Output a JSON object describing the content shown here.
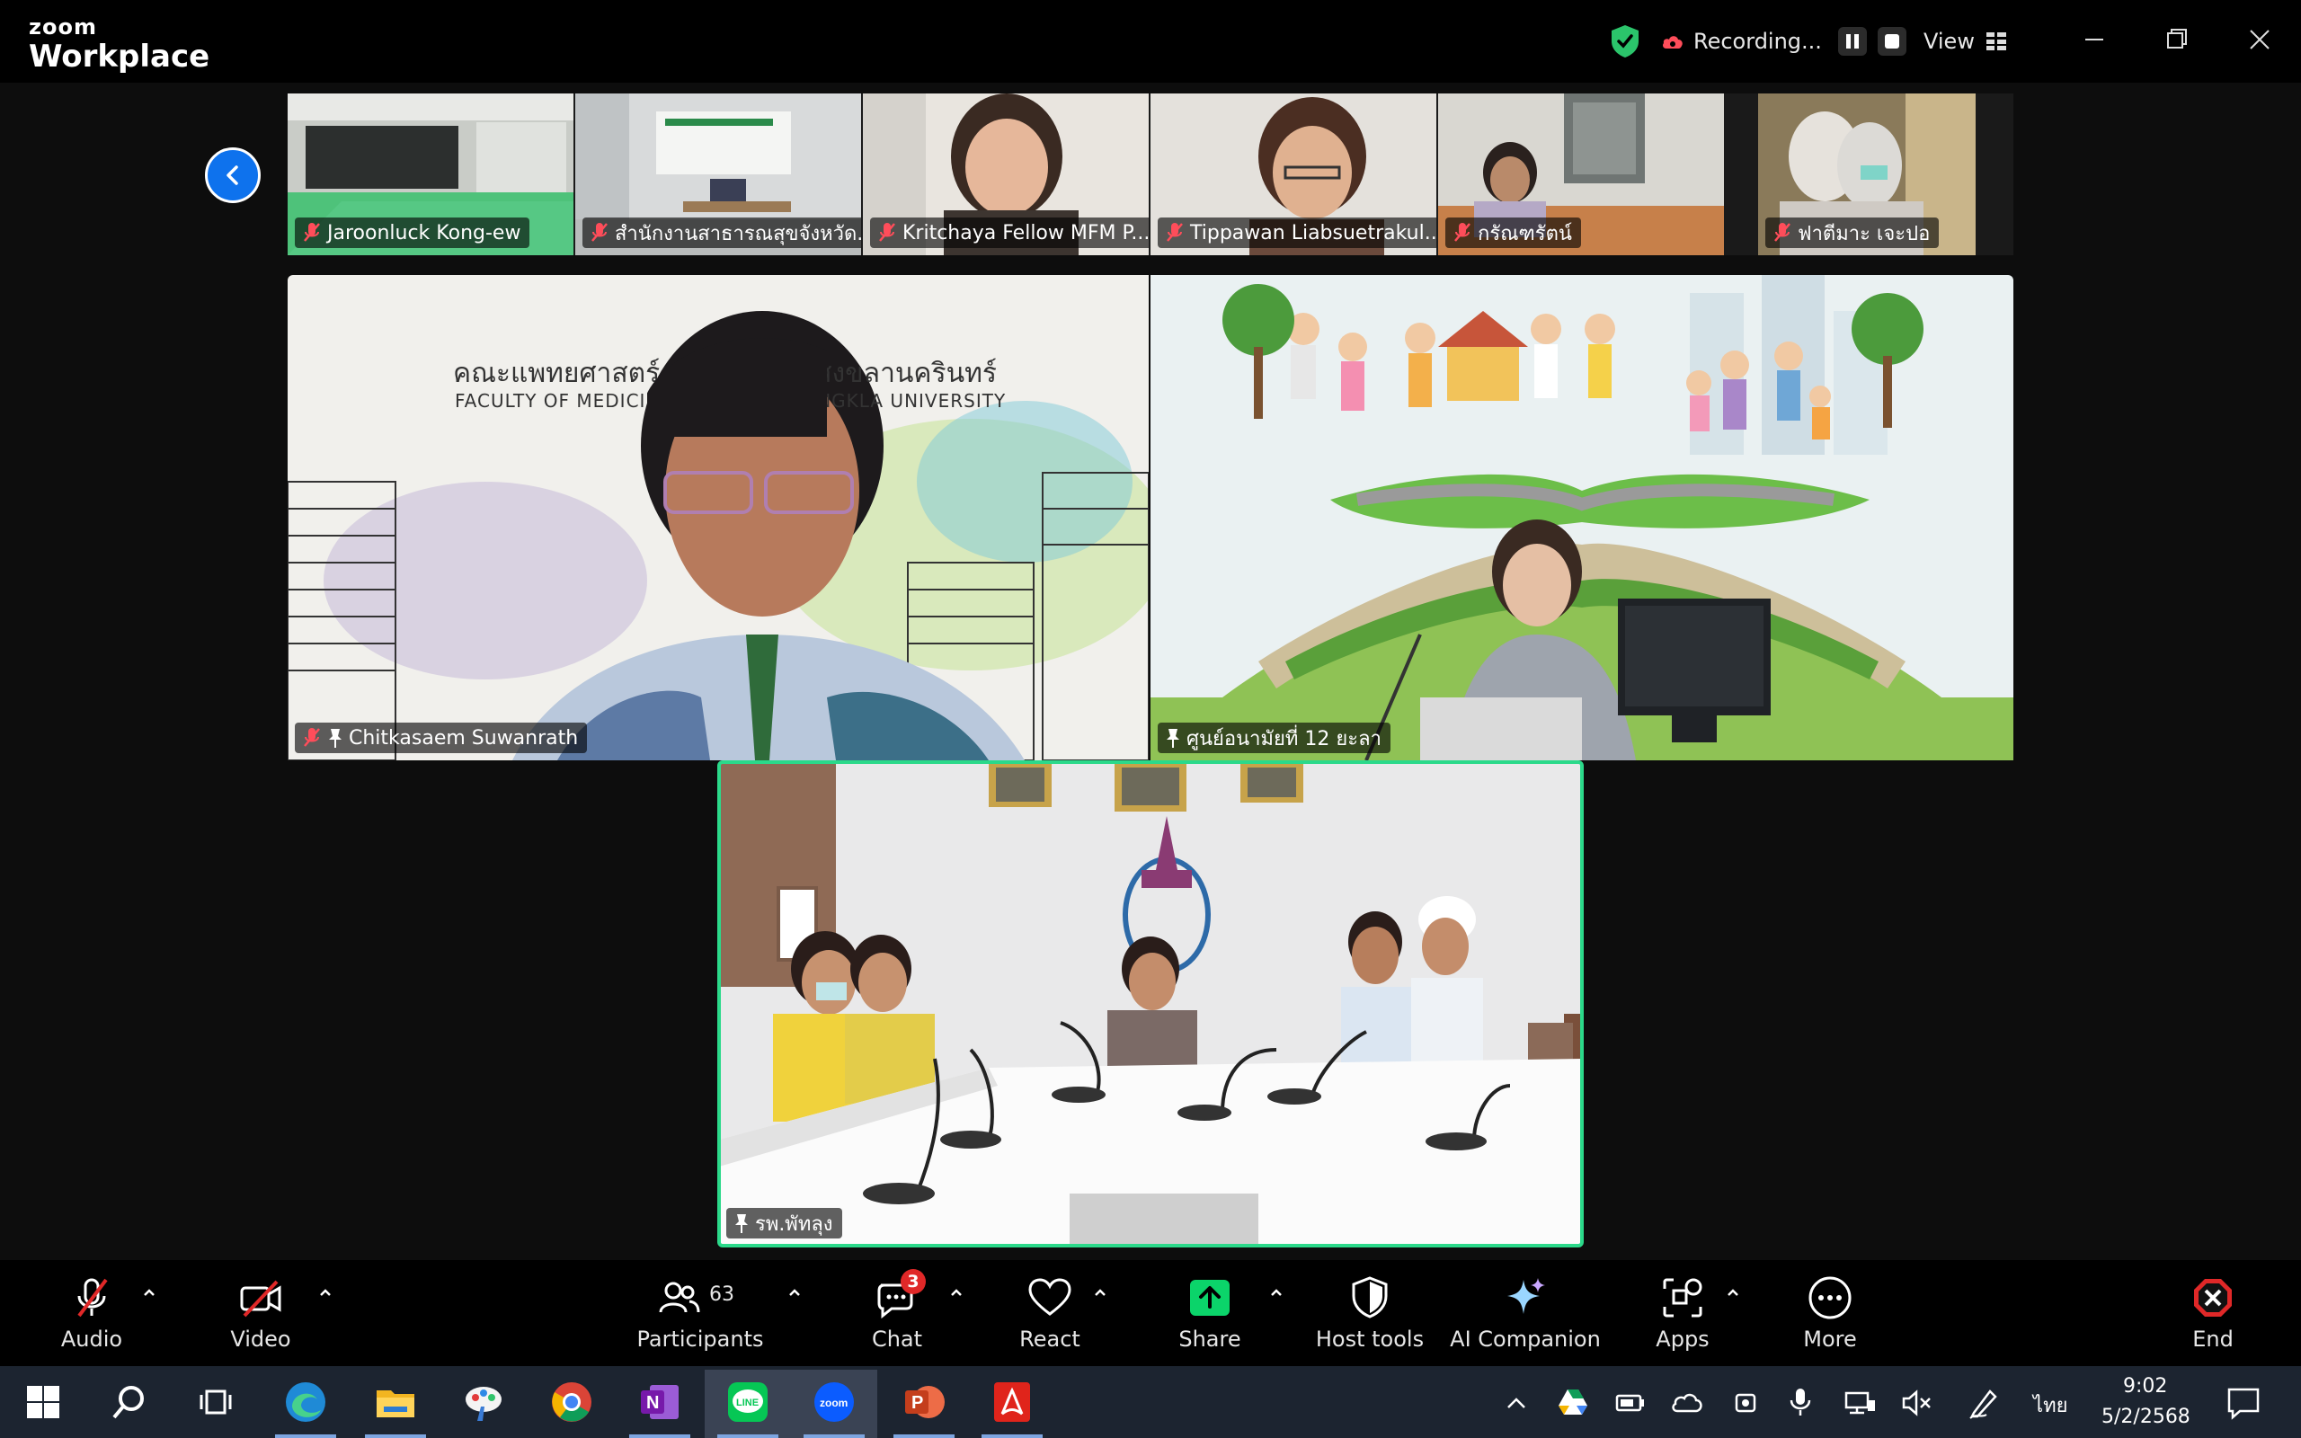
{
  "app": {
    "logo_small": "zoom",
    "logo_big": "Workplace"
  },
  "titlebar": {
    "recording_label": "Recording...",
    "view_label": "View"
  },
  "thumbnails": [
    {
      "name": "Jaroonluck Kong-ew",
      "muted": true
    },
    {
      "name": "สำนักงานสาธารณสุขจังหวัด...",
      "muted": true
    },
    {
      "name": "Kritchaya Fellow MFM P...",
      "muted": true
    },
    {
      "name": "Tippawan Liabsuetrakul...",
      "muted": true
    },
    {
      "name": "กรัณฑรัตน์",
      "muted": true
    },
    {
      "name": "ฟาตีมาะ เจะปอ",
      "muted": true
    }
  ],
  "main_tiles": [
    {
      "name": "Chitkasaem Suwanrath",
      "muted": true,
      "pinned": true,
      "banner_th": "คณะแพทยศาสตร์ มหาวิทยาลัยสงขลานครินทร์",
      "banner_en": "FACULTY OF MEDICINE PRINCE OF SONGKLA UNIVERSITY"
    },
    {
      "name": "ศูนย์อนามัยที่ 12 ยะลา",
      "muted": false,
      "pinned": true
    },
    {
      "name": "รพ.พัทลุง",
      "muted": false,
      "pinned": true,
      "active_speaker": true
    }
  ],
  "toolbar": {
    "audio": "Audio",
    "video": "Video",
    "participants": "Participants",
    "participants_count": "63",
    "chat": "Chat",
    "chat_badge": "3",
    "react": "React",
    "share": "Share",
    "host_tools": "Host tools",
    "ai_companion": "AI Companion",
    "apps": "Apps",
    "more": "More",
    "end": "End"
  },
  "taskbar": {
    "language": "ไทย",
    "time": "9:02",
    "date": "5/2/2568"
  },
  "colors": {
    "accent_blue": "#0e72ed",
    "share_green": "#0bd46a",
    "speaker_border": "#2bd98a",
    "end_red": "#e02828"
  }
}
